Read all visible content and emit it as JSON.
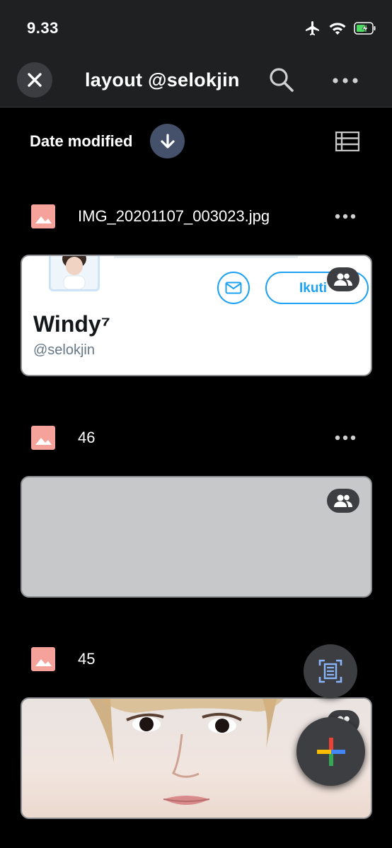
{
  "status_bar": {
    "time": "9.33"
  },
  "header": {
    "title": "layout @selokjin"
  },
  "sort": {
    "label": "Date modified"
  },
  "files": [
    {
      "name": "IMG_20201107_003023.jpg",
      "preview": {
        "display_name": "Windy⁷",
        "handle": "@selokjin",
        "follow_label": "Ikuti"
      }
    },
    {
      "name": "46"
    },
    {
      "name": "45"
    }
  ],
  "colors": {
    "background": "#000000",
    "toolbar": "#1f2022",
    "file_icon": "#f4a29a",
    "sort_button": "#45506a",
    "twitter_blue": "#1da1f2"
  },
  "icons": [
    "close-icon",
    "search-icon",
    "more-icon",
    "arrow-down-icon",
    "list-view-icon",
    "image-file-icon",
    "shared-people-icon",
    "scan-icon",
    "plus-icon",
    "mail-icon"
  ]
}
